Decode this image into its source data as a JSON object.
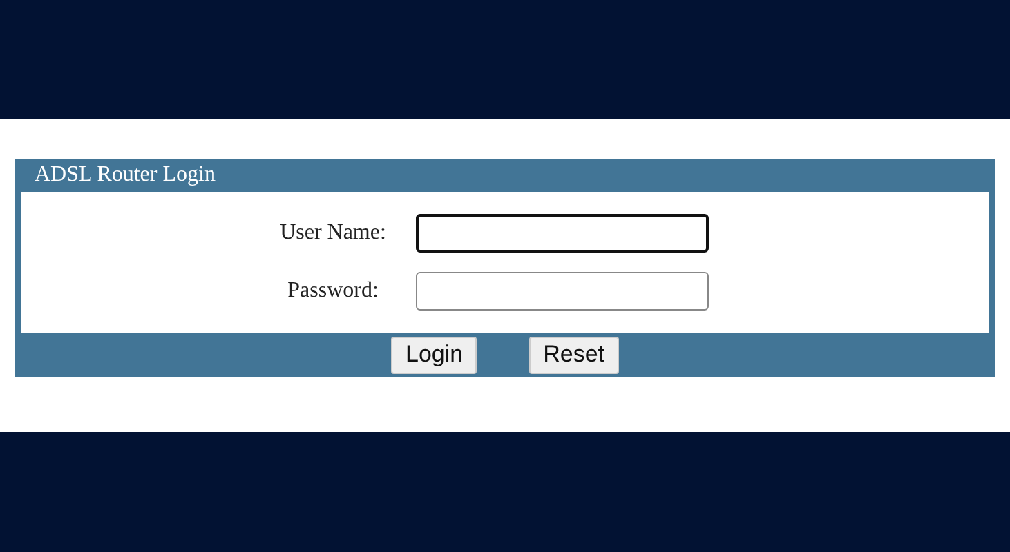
{
  "login_panel": {
    "title": "ADSL Router Login",
    "fields": [
      {
        "label": "User Name:",
        "focused": true
      },
      {
        "label": "Password:",
        "focused": false
      }
    ],
    "buttons": [
      "Login",
      "Reset"
    ]
  }
}
